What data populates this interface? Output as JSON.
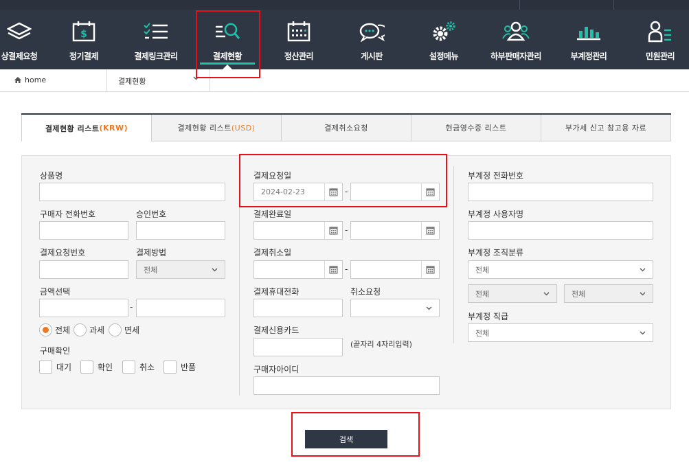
{
  "nav": {
    "items": [
      {
        "label": "상결제요청",
        "icon": "layers-icon"
      },
      {
        "label": "정기결제",
        "icon": "calendar-dollar-icon"
      },
      {
        "label": "결제링크관리",
        "icon": "checklist-icon"
      },
      {
        "label": "결제현황",
        "icon": "search-list-icon"
      },
      {
        "label": "정산관리",
        "icon": "calendar-grid-icon"
      },
      {
        "label": "게시판",
        "icon": "chat-bubbles-icon"
      },
      {
        "label": "설정메뉴",
        "icon": "gears-icon"
      },
      {
        "label": "하부판매자관리",
        "icon": "users-icon"
      },
      {
        "label": "부계정관리",
        "icon": "bar-chart-icon"
      },
      {
        "label": "민원관리",
        "icon": "person-list-icon"
      }
    ]
  },
  "breadcrumb": {
    "home": "home",
    "current": "결제현황"
  },
  "tabs": [
    {
      "label": "결제현황 리스트",
      "accent": "(KRW)"
    },
    {
      "label": "결제현황 리스트",
      "accent": "(USD)"
    },
    {
      "label": "결제취소요청",
      "accent": ""
    },
    {
      "label": "현금영수증 리스트",
      "accent": ""
    },
    {
      "label": "부가세 신고 참고용 자료",
      "accent": ""
    }
  ],
  "form": {
    "product_name": "상품명",
    "buyer_phone": "구매자 전화번호",
    "approval_no": "승인번호",
    "request_no": "결제요청번호",
    "pay_method": "결제방법",
    "pay_method_value": "전체",
    "amount_select": "금액선택",
    "tax_options": [
      "전체",
      "과세",
      "면세"
    ],
    "purchase_confirm": "구매확인",
    "confirm_options": [
      "대기",
      "확인",
      "취소",
      "반품"
    ],
    "request_date": "결제요청일",
    "request_date_value": "2024-02-23",
    "complete_date": "결제완료일",
    "cancel_date": "결제취소일",
    "mobile": "결제휴대전화",
    "cancel_request": "취소요청",
    "credit_card": "결제신용카드",
    "card_hint": "(끝자리 4자리입력)",
    "buyer_id": "구매자아이디",
    "sub_phone": "부계정 전화번호",
    "sub_user": "부계정 사용자명",
    "sub_org": "부계정 조직분류",
    "sub_org_value": "전체",
    "sub_org_a": "전체",
    "sub_org_b": "전체",
    "sub_rank": "부계정 직급",
    "sub_rank_value": "전체"
  },
  "search_button": "검색",
  "colors": {
    "nav_bg": "#2f3744",
    "accent_orange": "#f0781e",
    "active_teal": "#1fc0a8",
    "highlight_red": "#e8111a"
  }
}
